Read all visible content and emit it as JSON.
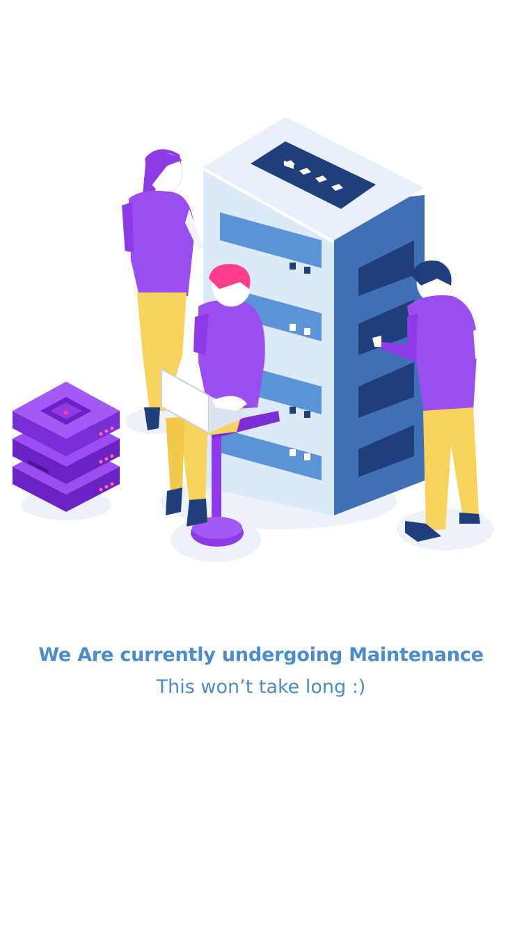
{
  "message": {
    "headline": "We Are currently undergoing Maintenance",
    "subline": "This won’t take long :)"
  },
  "illustration": {
    "name": "server-maintenance-illustration"
  },
  "colors": {
    "text": "#4a8ccc",
    "purple": "#8e3ae6",
    "yellow": "#f7d35c",
    "server_light": "#dbe9f8",
    "server_blue": "#4a82c8",
    "server_dark": "#1e3f7a",
    "skin": "#ffffff",
    "shadow": "#eef2f7"
  }
}
